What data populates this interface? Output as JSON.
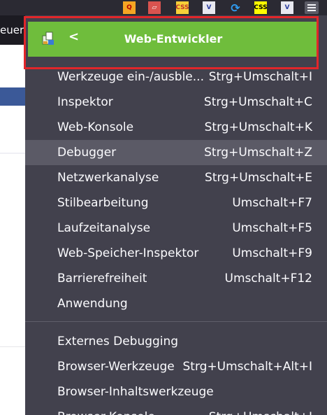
{
  "tab": {
    "partial_label": "euer"
  },
  "menu": {
    "title": "Web-Entwickler",
    "back_glyph": "<",
    "items": [
      {
        "label": "Werkzeuge ein-/ausble...",
        "shortcut": "Strg+Umschalt+I"
      },
      {
        "label": "Inspektor",
        "shortcut": "Strg+Umschalt+C"
      },
      {
        "label": "Web-Konsole",
        "shortcut": "Strg+Umschalt+K"
      },
      {
        "label": "Debugger",
        "shortcut": "Strg+Umschalt+Z",
        "highlighted": true
      },
      {
        "label": "Netzwerkanalyse",
        "shortcut": "Strg+Umschalt+E"
      },
      {
        "label": "Stilbearbeitung",
        "shortcut": "Umschalt+F7"
      },
      {
        "label": "Laufzeitanalyse",
        "shortcut": "Umschalt+F5"
      },
      {
        "label": "Web-Speicher-Inspektor",
        "shortcut": "Umschalt+F9"
      },
      {
        "label": "Barrierefreiheit",
        "shortcut": "Umschalt+F12"
      },
      {
        "label": "Anwendung",
        "shortcut": ""
      }
    ],
    "items2": [
      {
        "label": "Externes Debugging",
        "shortcut": ""
      },
      {
        "label": "Browser-Werkzeuge",
        "shortcut": "Strg+Umschalt+Alt+I"
      },
      {
        "label": "Browser-Inhaltswerkzeuge",
        "shortcut": ""
      },
      {
        "label": "Browser-Konsole",
        "shortcut": "Strg+Umschalt+J"
      }
    ]
  },
  "toolbar_icons": [
    {
      "name": "search-extension-icon",
      "glyph": "Q",
      "bg": "#f5a623",
      "fg": "#b00000"
    },
    {
      "name": "pdf-extension-icon",
      "glyph": "▱",
      "bg": "#d9534f",
      "fg": "#ffffff"
    },
    {
      "name": "css-viewer-icon",
      "glyph": "CSS",
      "bg": "#f7d038",
      "fg": "#c0392b"
    },
    {
      "name": "validator-v-icon",
      "glyph": "V",
      "bg": "#e8e8f0",
      "fg": "#2c3e9f"
    },
    {
      "name": "refresh-icon",
      "glyph": "⟳",
      "bg": "#2b2a33",
      "fg": "#2f9bf0"
    },
    {
      "name": "css-yellow-icon",
      "glyph": "CSS",
      "bg": "#ffff00",
      "fg": "#000000"
    },
    {
      "name": "validator-v2-icon",
      "glyph": "V",
      "bg": "#e8e8f0",
      "fg": "#2c3e9f"
    }
  ],
  "colors": {
    "header_green": "#6fbd3c",
    "highlight_frame": "#e2262a",
    "menu_bg": "#42414d",
    "menu_highlight": "#5b5a66"
  }
}
